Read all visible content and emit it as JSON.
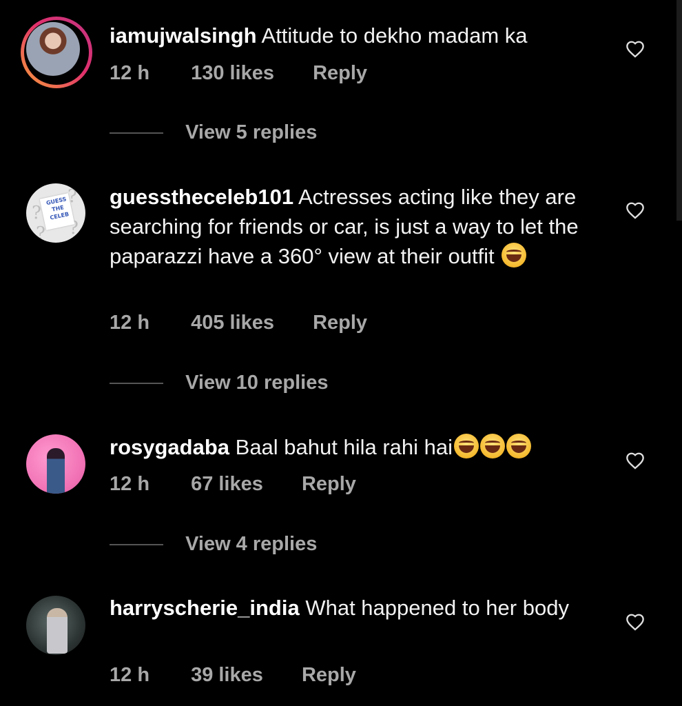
{
  "colors": {
    "background": "#000000",
    "text_primary": "#ffffff",
    "text_secondary": "#a8a8a8",
    "story_ring_start": "#f9a13a",
    "story_ring_end": "#c13584"
  },
  "comments": [
    {
      "username": "iamujwalsingh",
      "text": "Attitude to dekho madam ka",
      "emoji": [],
      "time": "12 h",
      "likes": "130 likes",
      "reply_label": "Reply",
      "view_replies": "View 5 replies",
      "has_story_ring": true,
      "icon": "heart-outline-icon"
    },
    {
      "username": "guesstheceleb101",
      "text": "Actresses acting like they are searching for friends or car, is just a way to let the paparazzi have a 360° view at their outfit",
      "emoji": [
        "grinning-sweat-emoji"
      ],
      "time": "12 h",
      "likes": "405 likes",
      "reply_label": "Reply",
      "view_replies": "View 10 replies",
      "avatar_text": [
        "GUESS",
        "THE",
        "CELEB"
      ],
      "icon": "heart-outline-icon"
    },
    {
      "username": "rosygadaba",
      "text": "Baal bahut hila rahi hai",
      "emoji": [
        "tears-of-joy-emoji",
        "tears-of-joy-emoji",
        "tears-of-joy-emoji"
      ],
      "time": "12 h",
      "likes": "67 likes",
      "reply_label": "Reply",
      "view_replies": "View 4 replies",
      "icon": "heart-outline-icon"
    },
    {
      "username": "harryscherie_india",
      "text": "What happened to her body",
      "emoji": [],
      "time": "12 h",
      "likes": "39 likes",
      "reply_label": "Reply",
      "icon": "heart-outline-icon"
    }
  ]
}
